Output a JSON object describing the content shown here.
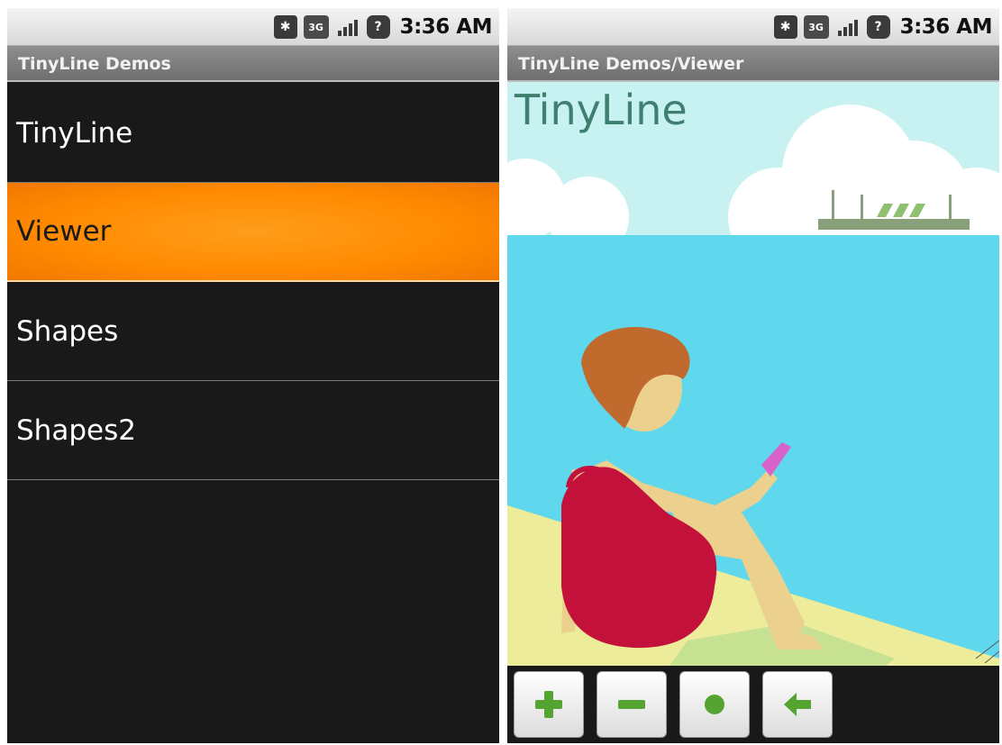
{
  "status": {
    "time": "3:36 AM",
    "icons": [
      "bluetooth-icon",
      "3g-icon",
      "signal-icon",
      "unknown-icon"
    ]
  },
  "left": {
    "title": "TinyLine Demos",
    "items": [
      {
        "label": "TinyLine",
        "selected": false
      },
      {
        "label": "Viewer",
        "selected": true
      },
      {
        "label": "Shapes",
        "selected": false
      },
      {
        "label": "Shapes2",
        "selected": false
      }
    ]
  },
  "right": {
    "title": "TinyLine Demos/Viewer",
    "viewer_title": "TinyLine",
    "toolbar": [
      "zoom-in-icon",
      "zoom-out-icon",
      "reset-icon",
      "back-icon"
    ]
  },
  "colors": {
    "selected": "#ff8a00",
    "sky": "#c8f2f2",
    "sea": "#5fd8ee",
    "sand": "#ecec9a",
    "dress": "#c4113c",
    "hair": "#c06a2e",
    "skin": "#ebd08e",
    "phone": "#d962c8",
    "button_green": "#55a330"
  }
}
